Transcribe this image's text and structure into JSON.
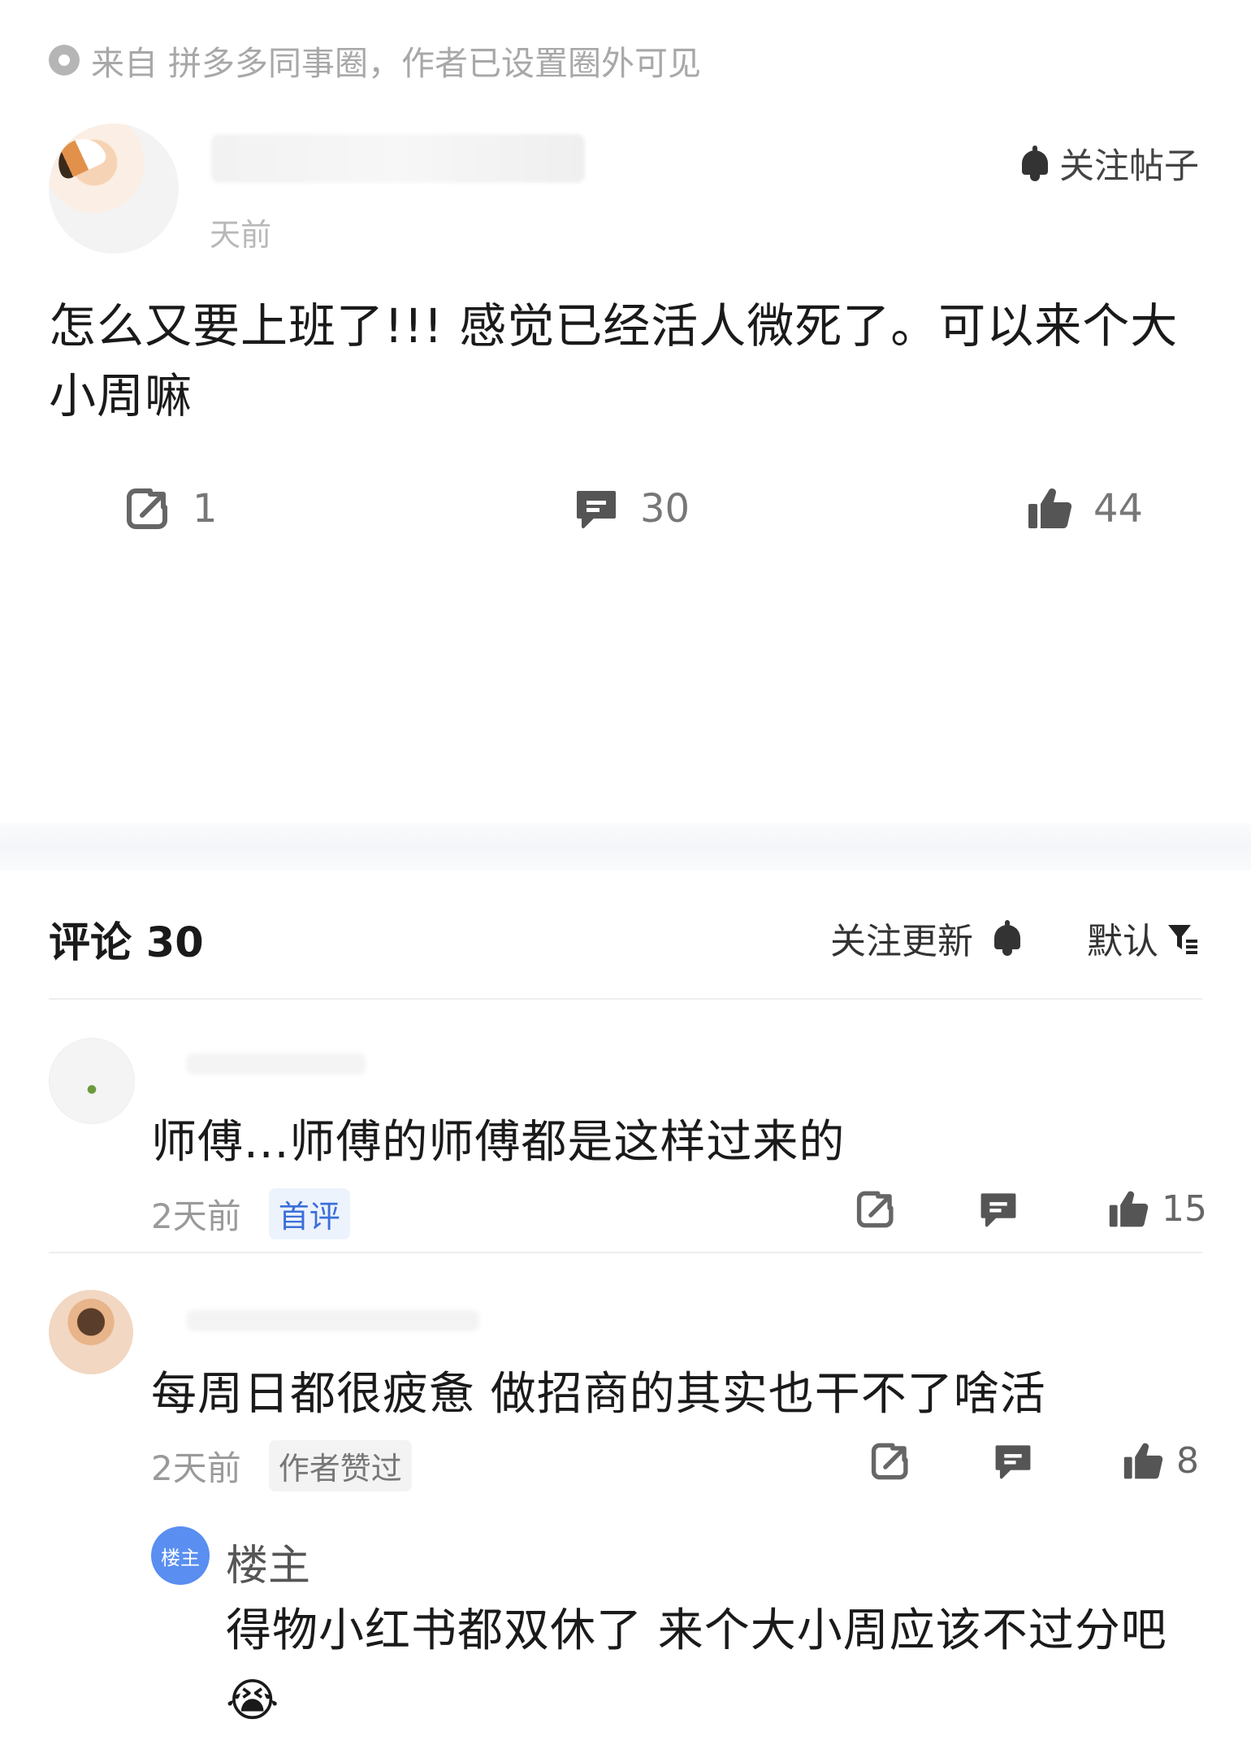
{
  "source": {
    "text": "来自 拼多多同事圈，作者已设置圈外可见"
  },
  "post": {
    "time": "天前",
    "follow_label": "关注帖子",
    "content": "怎么又要上班了!!! 感觉已经活人微死了。可以来个大小周嘛",
    "share_count": "1",
    "comment_count": "30",
    "like_count": "44"
  },
  "comments_header": {
    "title": "评论 30",
    "follow_update": "关注更新",
    "sort": "默认"
  },
  "comments": [
    {
      "text": "师傅...师傅的师傅都是这样过来的",
      "time": "2天前",
      "tag": "首评",
      "like_count": "15"
    },
    {
      "text": "每周日都很疲惫  做招商的其实也干不了啥活",
      "time": "2天前",
      "tag": "作者赞过",
      "like_count": "8",
      "reply": {
        "badge": "楼主",
        "name": "楼主",
        "text": "得物小红书都双休了 来个大小周应该不过分吧😭"
      }
    }
  ]
}
